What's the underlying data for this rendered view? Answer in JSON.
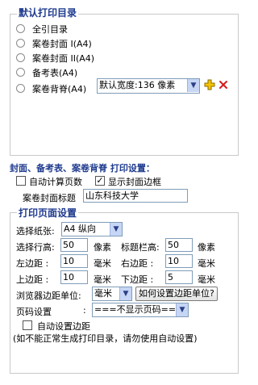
{
  "catalog": {
    "legend": "默认打印目录",
    "options": [
      {
        "label": "全引目录"
      },
      {
        "label": "案卷封面 I(A4)"
      },
      {
        "label": "案卷封面 II(A4)"
      },
      {
        "label": "备考表(A4)"
      },
      {
        "label": "案卷背脊(A4)"
      }
    ],
    "spine_width_select": "默认宽度:136 像素",
    "add_icon": "plus-icon",
    "delete_icon": "close-icon"
  },
  "print_settings": {
    "title": "封面、备考表、案卷背脊 打印设置：",
    "auto_page_count_label": "自动计算页数",
    "auto_page_count_checked": false,
    "show_border_label": "显示封面边框",
    "show_border_checked": true,
    "cover_title_label": "案卷封面标题",
    "cover_title_value": "山东科技大学"
  },
  "page_setup": {
    "legend": "打印页面设置",
    "paper_label": "选择纸张:",
    "paper_value": "A4 纵向",
    "row_height_label": "选择行高:",
    "row_height_value": "50",
    "row_height_unit": "像素",
    "header_height_label": "标题栏高:",
    "header_height_value": "50",
    "header_height_unit": "像素",
    "left_margin_label": "左边距  :",
    "left_margin_value": "10",
    "left_margin_unit": "毫米",
    "right_margin_label": "右边距  :",
    "right_margin_value": "10",
    "right_margin_unit": "毫米",
    "top_margin_label": "上边距  :",
    "top_margin_value": "10",
    "top_margin_unit": "毫米",
    "bottom_margin_label": "下边距  :",
    "bottom_margin_value": "5",
    "bottom_margin_unit": "毫米",
    "browser_margin_unit_label": "浏览器边距单位:",
    "browser_margin_unit_value": "毫米",
    "how_to_button": "如何设置边距单位?",
    "page_number_label": "页码设置",
    "page_number_colon": ":",
    "page_number_value": "===不显示页码===",
    "auto_margin_label": "自动设置边距",
    "auto_margin_checked": false,
    "hint": "(如不能正常生成打印目录，请勿使用自动设置)"
  }
}
